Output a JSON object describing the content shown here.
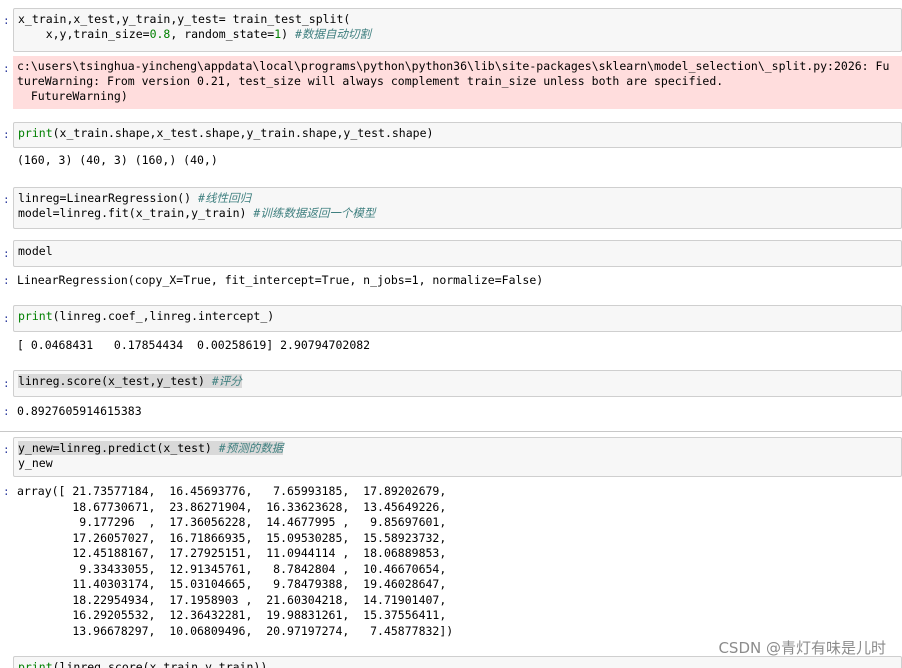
{
  "cells": {
    "split": {
      "code_l1": "x_train,x_test,y_train,y_test= train_test_split(",
      "code_l2_a": "    x,y,train_size=",
      "code_l2_num1": "0.8",
      "code_l2_b": ", random_state=",
      "code_l2_num2": "1",
      "code_l2_c": ") ",
      "comment": "#数据自动切割",
      "warning_l1": "c:\\users\\tsinghua-yincheng\\appdata\\local\\programs\\python\\python36\\lib\\site-packages\\sklearn\\model_selection\\_split.py:2026: Fu",
      "warning_l2": "tureWarning: From version 0.21, test_size will always complement train_size unless both are specified.",
      "warning_l3": "  FutureWarning)"
    },
    "shapes": {
      "kw": "print",
      "rest": "(x_train.shape,x_test.shape,y_train.shape,y_test.shape)",
      "output": "(160, 3) (40, 3) (160,) (40,)"
    },
    "fit": {
      "l1_code": "linreg=LinearRegression() ",
      "l1_comment": "#线性回归",
      "l2_code": "model=linreg.fit(x_train,y_train) ",
      "l2_comment": "#训练数据返回一个模型"
    },
    "model": {
      "code": "model",
      "output": "LinearRegression(copy_X=True, fit_intercept=True, n_jobs=1, normalize=False)"
    },
    "coef": {
      "kw": "print",
      "rest": "(linreg.coef_,linreg.intercept_)",
      "output": "[ 0.0468431   0.17854434  0.00258619] 2.90794702082"
    },
    "score": {
      "code": "linreg.score(x_test,y_test) ",
      "comment": "#评分",
      "output": "0.8927605914615383"
    },
    "predict": {
      "l1_code": "y_new=linreg.predict(x_test) ",
      "l1_comment": "#预测的数据",
      "l2_code": "y_new",
      "output_lines": [
        "array([ 21.73577184,  16.45693776,   7.65993185,  17.89202679,",
        "        18.67730671,  23.86271904,  16.33623628,  13.45649226,",
        "         9.177296  ,  17.36056228,  14.4677995 ,   9.85697601,",
        "        17.26057027,  16.71866935,  15.09530285,  15.58923732,",
        "        12.45188167,  17.27925151,  11.0944114 ,  18.06889853,",
        "         9.33433055,  12.91345761,   8.7842804 ,  10.46670654,",
        "        11.40303174,  15.03104665,   9.78479388,  19.46028647,",
        "        18.22954934,  17.1958903 ,  21.60304218,  14.71901407,",
        "        16.29205532,  12.36432281,  19.98831261,  15.37556411,",
        "        13.96678297,  10.06809496,  20.97197274,   7.45877832])"
      ]
    },
    "train_score": {
      "kw": "print",
      "rest": "(linreg.score(x_train,y_train))"
    }
  },
  "watermark": "CSDN @青灯有味是儿时"
}
